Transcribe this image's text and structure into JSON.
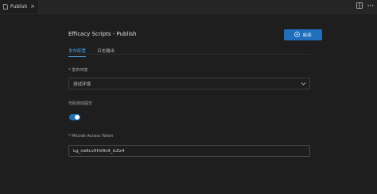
{
  "tab": {
    "label": "Publish",
    "close": "×"
  },
  "page": {
    "title": "Efficacy Scripts - Publish",
    "start_button": "启动",
    "subtabs": [
      "发布配置",
      "日志输出"
    ],
    "env_label": "* 发布环境",
    "env_value": "测试环境",
    "auto_commit_label": "代码自动提交",
    "auto_commit_on": true,
    "token_label": "* Micode Access Token",
    "token_value": "Lg_ne6cv5hV9c9_icZx4"
  },
  "colors": {
    "accent": "#1f6fbd",
    "tab_active_text": "#4a9ede",
    "background": "#1e1e1e"
  },
  "icons": {
    "tab": "file-icon",
    "split": "split-editor-icon",
    "more": "more-icon",
    "start": "play-circle-icon",
    "select": "chevron-down-icon"
  }
}
